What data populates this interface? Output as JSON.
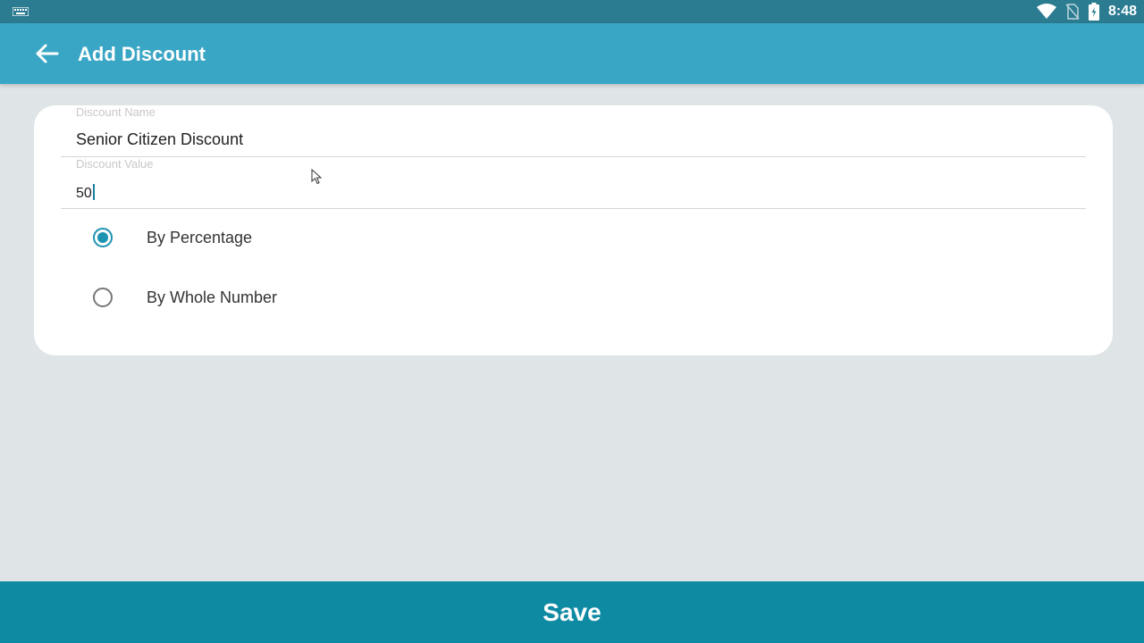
{
  "status_bar": {
    "time": "8:48",
    "icons": [
      "keyboard-icon",
      "wifi-icon",
      "no-sim-icon",
      "battery-charging-icon"
    ]
  },
  "app_bar": {
    "title": "Add Discount",
    "back_icon": "arrow-left-icon"
  },
  "form": {
    "discount_name": {
      "label": "Discount Name",
      "value": "Senior Citizen Discount"
    },
    "discount_value": {
      "label": "Discount Value",
      "value": "50"
    },
    "discount_type": {
      "options": [
        {
          "label": "By Percentage",
          "selected": true
        },
        {
          "label": "By Whole Number",
          "selected": false
        }
      ]
    }
  },
  "footer": {
    "save_label": "Save"
  },
  "colors": {
    "status_bar": "#2b7b91",
    "app_bar": "#3aa6c5",
    "accent": "#1d93b2",
    "save_bar": "#0f8aa3",
    "background": "#dfe4e7"
  }
}
